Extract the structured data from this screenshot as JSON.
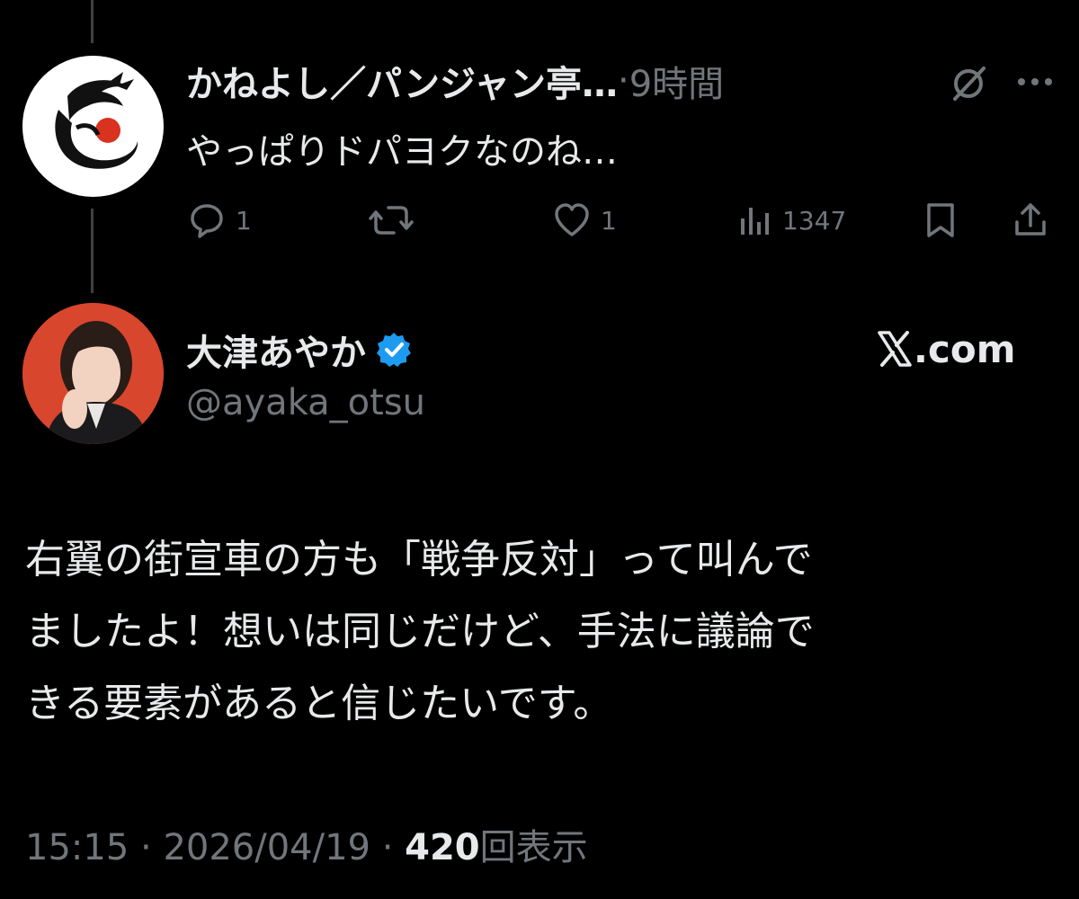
{
  "reply": {
    "author_name": "かねよし／パンジャン亭…",
    "separator": "·",
    "time_ago": "9時間",
    "text": "やっぱりドパヨクなのね…",
    "avatar_icon": "dragon-logo-icon",
    "actions": {
      "reply_count": "1",
      "retweet_count": "",
      "like_count": "1",
      "view_count": "1347"
    }
  },
  "main_post": {
    "author_name": "大津あやか",
    "verified": true,
    "handle": "@ayaka_otsu",
    "site_label": ".com",
    "site_logo_icon": "x-logo-icon",
    "text_lines": [
      "右翼の街宣車の方も「戦争反対」って叫んで",
      "ましたよ！想いは同じだけど、手法に議論で",
      "きる要素があると信じたいです。"
    ],
    "time": "15:15",
    "sep1": " · ",
    "date": "2026/04/19",
    "sep2": " · ",
    "views_count": "420",
    "views_label": "回表示"
  },
  "colors": {
    "background": "#000000",
    "text": "#e7e9ea",
    "muted": "#71767b",
    "verified_blue": "#1d9bf0",
    "thread_line": "#3e4144"
  }
}
